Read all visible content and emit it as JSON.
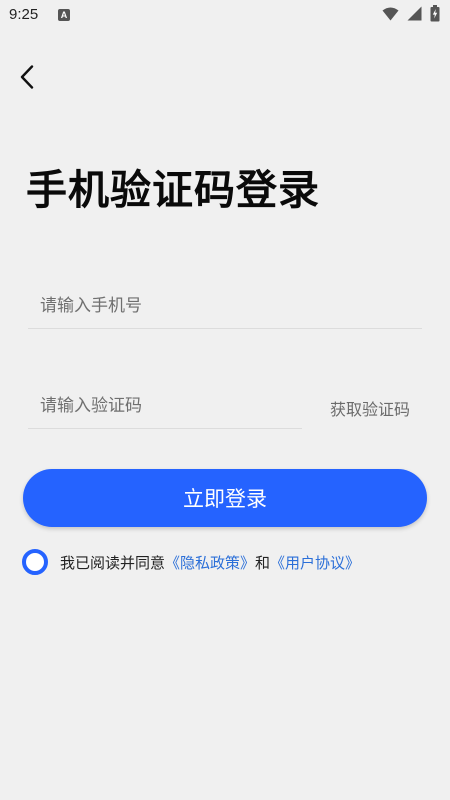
{
  "status_bar": {
    "time": "9:25",
    "notification_icon_label": "A",
    "icons": [
      "a-notification-icon",
      "wifi-icon",
      "signal-icon",
      "battery-charging-icon"
    ]
  },
  "header": {
    "back_icon": "chevron-left-icon"
  },
  "title": "手机验证码登录",
  "phone_input": {
    "placeholder": "请输入手机号",
    "value": ""
  },
  "code_input": {
    "placeholder": "请输入验证码",
    "value": ""
  },
  "get_code_label": "获取验证码",
  "login_button_label": "立即登录",
  "agreement": {
    "prefix": "我已阅读并同意",
    "privacy_label": "《隐私政策》",
    "conjunction": "和",
    "terms_label": "《用户协议》"
  },
  "colors": {
    "accent": "#2563ff",
    "link": "#2b6fd8",
    "background": "#f0f0f0"
  }
}
